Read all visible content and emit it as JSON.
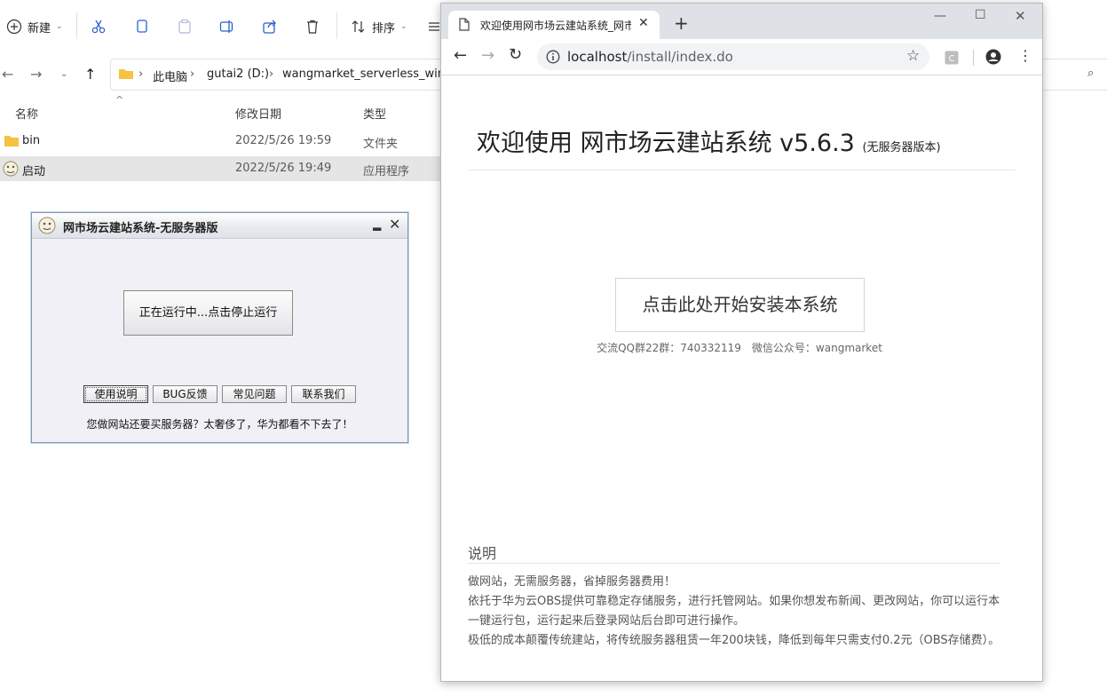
{
  "explorer": {
    "toolbar": {
      "new_label": "新建",
      "sort_label": "排序"
    },
    "breadcrumb": [
      "此电脑",
      "gutai2 (D:)",
      "wangmarket_serverless_window"
    ],
    "columns": {
      "name": "名称",
      "modified": "修改日期",
      "type": "类型"
    },
    "rows": [
      {
        "name": "bin",
        "modified": "2022/5/26 19:59",
        "type": "文件夹"
      },
      {
        "name": "启动",
        "modified": "2022/5/26 19:49",
        "type": "应用程序"
      }
    ]
  },
  "swing": {
    "title": "网市场云建站系统-无服务器版",
    "run_button": "正在运行中...点击停止运行",
    "buttons": [
      "使用说明",
      "BUG反馈",
      "常见问题",
      "联系我们"
    ],
    "footer": "您做网站还要买服务器？太奢侈了，华为都看不下去了！"
  },
  "browser": {
    "tab_title": "欢迎使用网市场云建站系统_网市",
    "url_host": "localhost",
    "url_path": "/install/index.do",
    "page_title": "欢迎使用 网市场云建站系统 v5.6.3",
    "page_title_note": "(无服务器版本)",
    "install_button": "点击此处开始安装本系统",
    "contact": "交流QQ群22群：740332119　微信公众号：wangmarket",
    "notes_heading": "说明",
    "notes": [
      "做网站，无需服务器，省掉服务器费用！",
      "依托于华为云OBS提供可靠稳定存储服务，进行托管网站。如果你想发布新闻、更改网站，你可以运行本一键运行包，运行起来后登录网站后台即可进行操作。",
      "极低的成本颠覆传统建站，将传统服务器租赁一年200块钱，降低到每年只需支付0.2元（OBS存储费）。"
    ]
  }
}
